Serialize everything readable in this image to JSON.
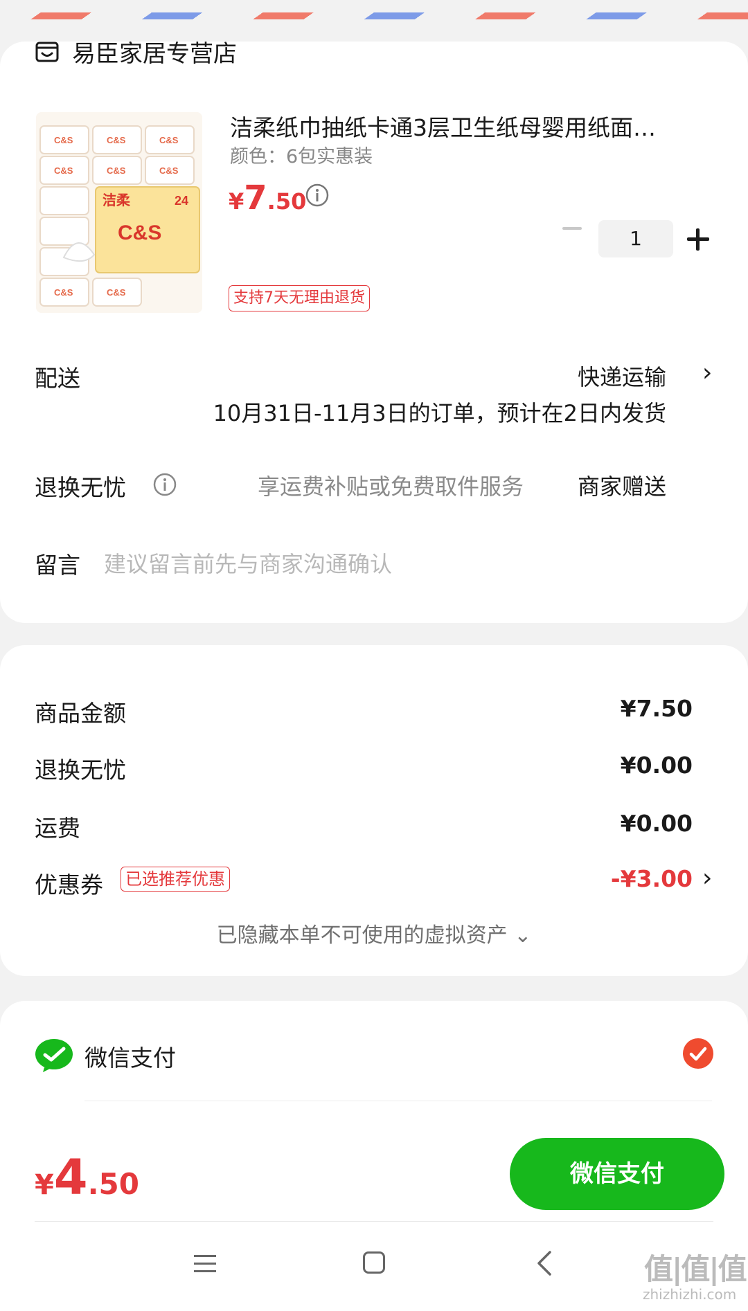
{
  "shop": {
    "name": "易臣家居专营店"
  },
  "product": {
    "title": "洁柔纸巾抽纸卡通3层卫生纸母婴用纸面…",
    "variant": "颜色：6包实惠装",
    "price_symbol": "¥",
    "price_int": "7",
    "price_dec": ".50",
    "quantity": "1",
    "return_badge": "支持7天无理由退货",
    "image_brand_text": "C&S",
    "image_label": "洁柔",
    "image_count": "24"
  },
  "delivery": {
    "label": "配送",
    "method": "快递运输",
    "estimate": "10月31日-11月3日的订单，预计在2日内发货"
  },
  "returns": {
    "label": "退换无忧",
    "description": "享运费补贴或免费取件服务",
    "provider": "商家赠送"
  },
  "message": {
    "label": "留言",
    "placeholder": "建议留言前先与商家沟通确认"
  },
  "summary": {
    "items": [
      {
        "label": "商品金额",
        "value": "¥7.50"
      },
      {
        "label": "退换无忧",
        "value": "¥0.00"
      },
      {
        "label": "运费",
        "value": "¥0.00"
      },
      {
        "label": "优惠券",
        "value": "-¥3.00"
      }
    ],
    "coupon_badge": "已选推荐优惠",
    "hidden_assets": "已隐藏本单不可使用的虚拟资产 ⌄"
  },
  "payment": {
    "method": "微信支付",
    "total_symbol": "¥",
    "total_int": "4",
    "total_dec": ".50",
    "button_label": "微信支付"
  },
  "watermark": {
    "text": "值|值|值",
    "url": "zhizhizhi.com"
  },
  "colors": {
    "accent_red": "#e4393c",
    "wechat_green": "#17b81c",
    "background": "#f2f2f2"
  }
}
